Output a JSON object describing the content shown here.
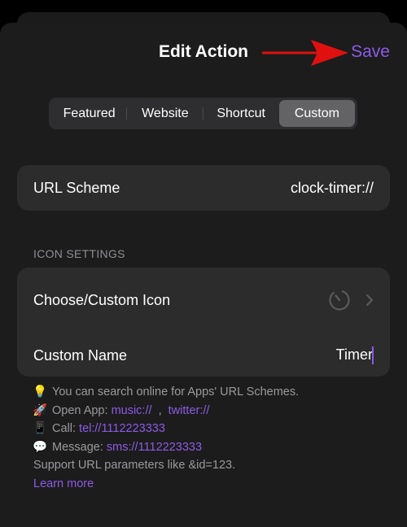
{
  "header": {
    "title": "Edit Action",
    "save_label": "Save",
    "accent_color": "#8c5be6",
    "annotation": "red-arrow-pointing-to-save"
  },
  "segmented_control": {
    "items": [
      {
        "label": "Featured",
        "active": false
      },
      {
        "label": "Website",
        "active": false
      },
      {
        "label": "Shortcut",
        "active": false
      },
      {
        "label": "Custom",
        "active": true
      }
    ]
  },
  "url_scheme": {
    "label": "URL Scheme",
    "value": "clock-timer://"
  },
  "icon_settings": {
    "section_title": "ICON SETTINGS",
    "choose_icon_label": "Choose/Custom Icon",
    "current_icon": "timer-icon",
    "custom_name_label": "Custom Name",
    "custom_name_value": "Timer"
  },
  "info": {
    "tip_icon": "lightbulb-icon",
    "tip_text": "You can search online for Apps' URL Schemes.",
    "open_app_icon": "rocket-icon",
    "open_app_label": "Open App:",
    "open_app_link1": "music://",
    "open_app_separator": ",",
    "open_app_link2": "twitter://",
    "call_icon": "phone-icon",
    "call_label": "Call:",
    "call_link": "tel://1112223333",
    "message_icon": "speech-bubble-icon",
    "message_label": "Message:",
    "message_link": "sms://1112223333",
    "params_text": "Support URL parameters like &id=123.",
    "learn_more": "Learn more"
  }
}
